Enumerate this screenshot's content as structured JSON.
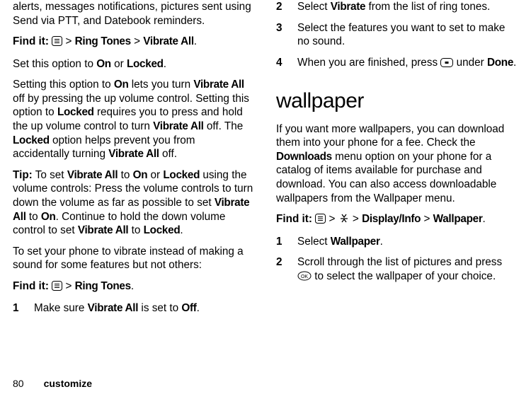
{
  "left": {
    "p1": "alerts, messages notifications, pictures sent using Send via PTT, and Datebook reminders.",
    "find1_label": "Find it:",
    "find1_a": "Ring Tones",
    "find1_b": "Vibrate All",
    "p2_a": "Set this option to ",
    "p2_b": " or ",
    "p3_a": "Setting this option to ",
    "p3_b": " lets you turn ",
    "p3_c": " off by pressing the up volume control. Setting this option to ",
    "p3_d": " requires you to press and hold the up volume control to turn ",
    "p3_e": " off. The ",
    "p3_f": " option helps prevent you from accidentally turning ",
    "p3_g": " off.",
    "tip_label": "Tip:",
    "tip_a": " To set ",
    "tip_b": " to ",
    "tip_c": " or ",
    "tip_d": " using the volume controls: Press the volume controls to turn down the volume as far as possible to set ",
    "tip_e": " to ",
    "tip_f": ". Continue to hold the down volume control to set ",
    "tip_g": " to ",
    "p4": "To set your phone to vibrate instead of making a sound for some features but not others:",
    "find2_label": "Find it:",
    "find2_a": "Ring Tones",
    "step1n": "1",
    "step1_a": "Make sure ",
    "step1_b": " is set to ",
    "on": "On",
    "off": "Off",
    "locked": "Locked",
    "vibrate_all": "Vibrate All"
  },
  "right": {
    "step2n": "2",
    "step2_a": "Select ",
    "step2_b": " from the list of ring tones.",
    "vibrate": "Vibrate",
    "step3n": "3",
    "step3": "Select the features you want to set to make no sound.",
    "step4n": "4",
    "step4_a": "When you are finished, press ",
    "step4_b": " under ",
    "done": "Done",
    "h2": "wallpaper",
    "wp_a": "If you want more wallpapers, you can download them into your phone for a fee. Check the ",
    "downloads": "Downloads",
    "wp_b": " menu option on your phone for a catalog of items available for purchase and download. You can also access downloadable wallpapers from the Wallpaper menu.",
    "find_label": "Find it:",
    "find_a": "Display/Info",
    "find_b": "Wallpaper",
    "wallpaper": "Wallpaper",
    "s1n": "1",
    "s1_a": "Select ",
    "s2n": "2",
    "s2_a": "Scroll through the list of pictures and press ",
    "s2_b": " to select the wallpaper of your choice."
  },
  "footer": {
    "page": "80",
    "section": "customize"
  }
}
